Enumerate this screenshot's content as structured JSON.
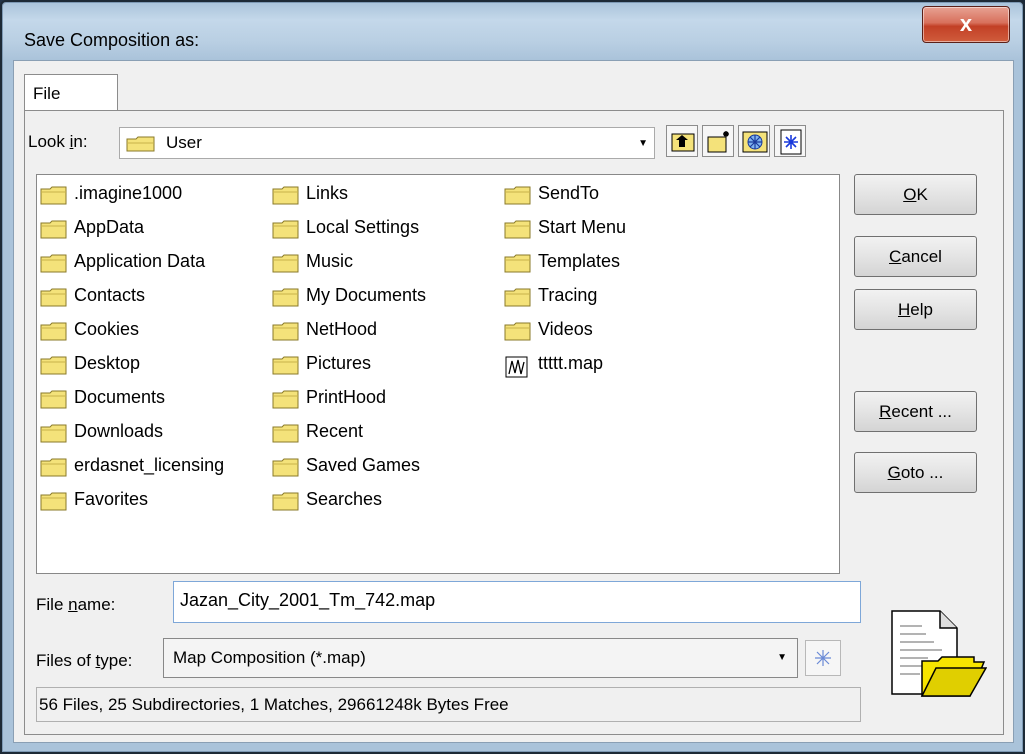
{
  "window": {
    "title": "Save Composition as:",
    "close_label": "x"
  },
  "tabs": [
    {
      "label": "File"
    }
  ],
  "look_in": {
    "label_pre": "Look ",
    "label_accel": "i",
    "label_post": "n:",
    "value": "User"
  },
  "toolbar": [
    {
      "name": "up-folder-icon"
    },
    {
      "name": "new-folder-icon"
    },
    {
      "name": "browse-icon"
    },
    {
      "name": "refresh-icon"
    }
  ],
  "files": {
    "columns": [
      [
        ".imagine1000",
        "AppData",
        "Application Data",
        "Contacts",
        "Cookies",
        "Desktop",
        "Documents",
        "Downloads",
        "erdasnet_licensing",
        "Favorites"
      ],
      [
        "Links",
        "Local Settings",
        "Music",
        "My Documents",
        "NetHood",
        "Pictures",
        "PrintHood",
        "Recent",
        "Saved Games",
        "Searches"
      ],
      [
        "SendTo",
        "Start Menu",
        "Templates",
        "Tracing",
        "Videos",
        "ttttt.map"
      ]
    ]
  },
  "buttons": {
    "ok": {
      "accel": "O",
      "rest": "K"
    },
    "cancel": {
      "accel": "C",
      "rest": "ancel"
    },
    "help": {
      "accel": "H",
      "rest": "elp"
    },
    "recent": {
      "accel": "R",
      "rest": "ecent ..."
    },
    "goto": {
      "accel": "G",
      "rest": "oto ..."
    }
  },
  "file_name": {
    "label_pre": "File ",
    "label_accel": "n",
    "label_post": "ame:",
    "value": "Jazan_City_2001_Tm_742.map"
  },
  "files_of_type": {
    "label_pre": "Files of ",
    "label_accel": "t",
    "label_post": "ype:",
    "value": "Map Composition (*.map)"
  },
  "status": "56 Files, 25 Subdirectories, 1 Matches, 29661248k Bytes Free",
  "colors": {
    "folder": "#f4e27a",
    "folder_edge": "#8a7a2a",
    "title_glass": "#b9cfe3",
    "close": "#c24026"
  }
}
